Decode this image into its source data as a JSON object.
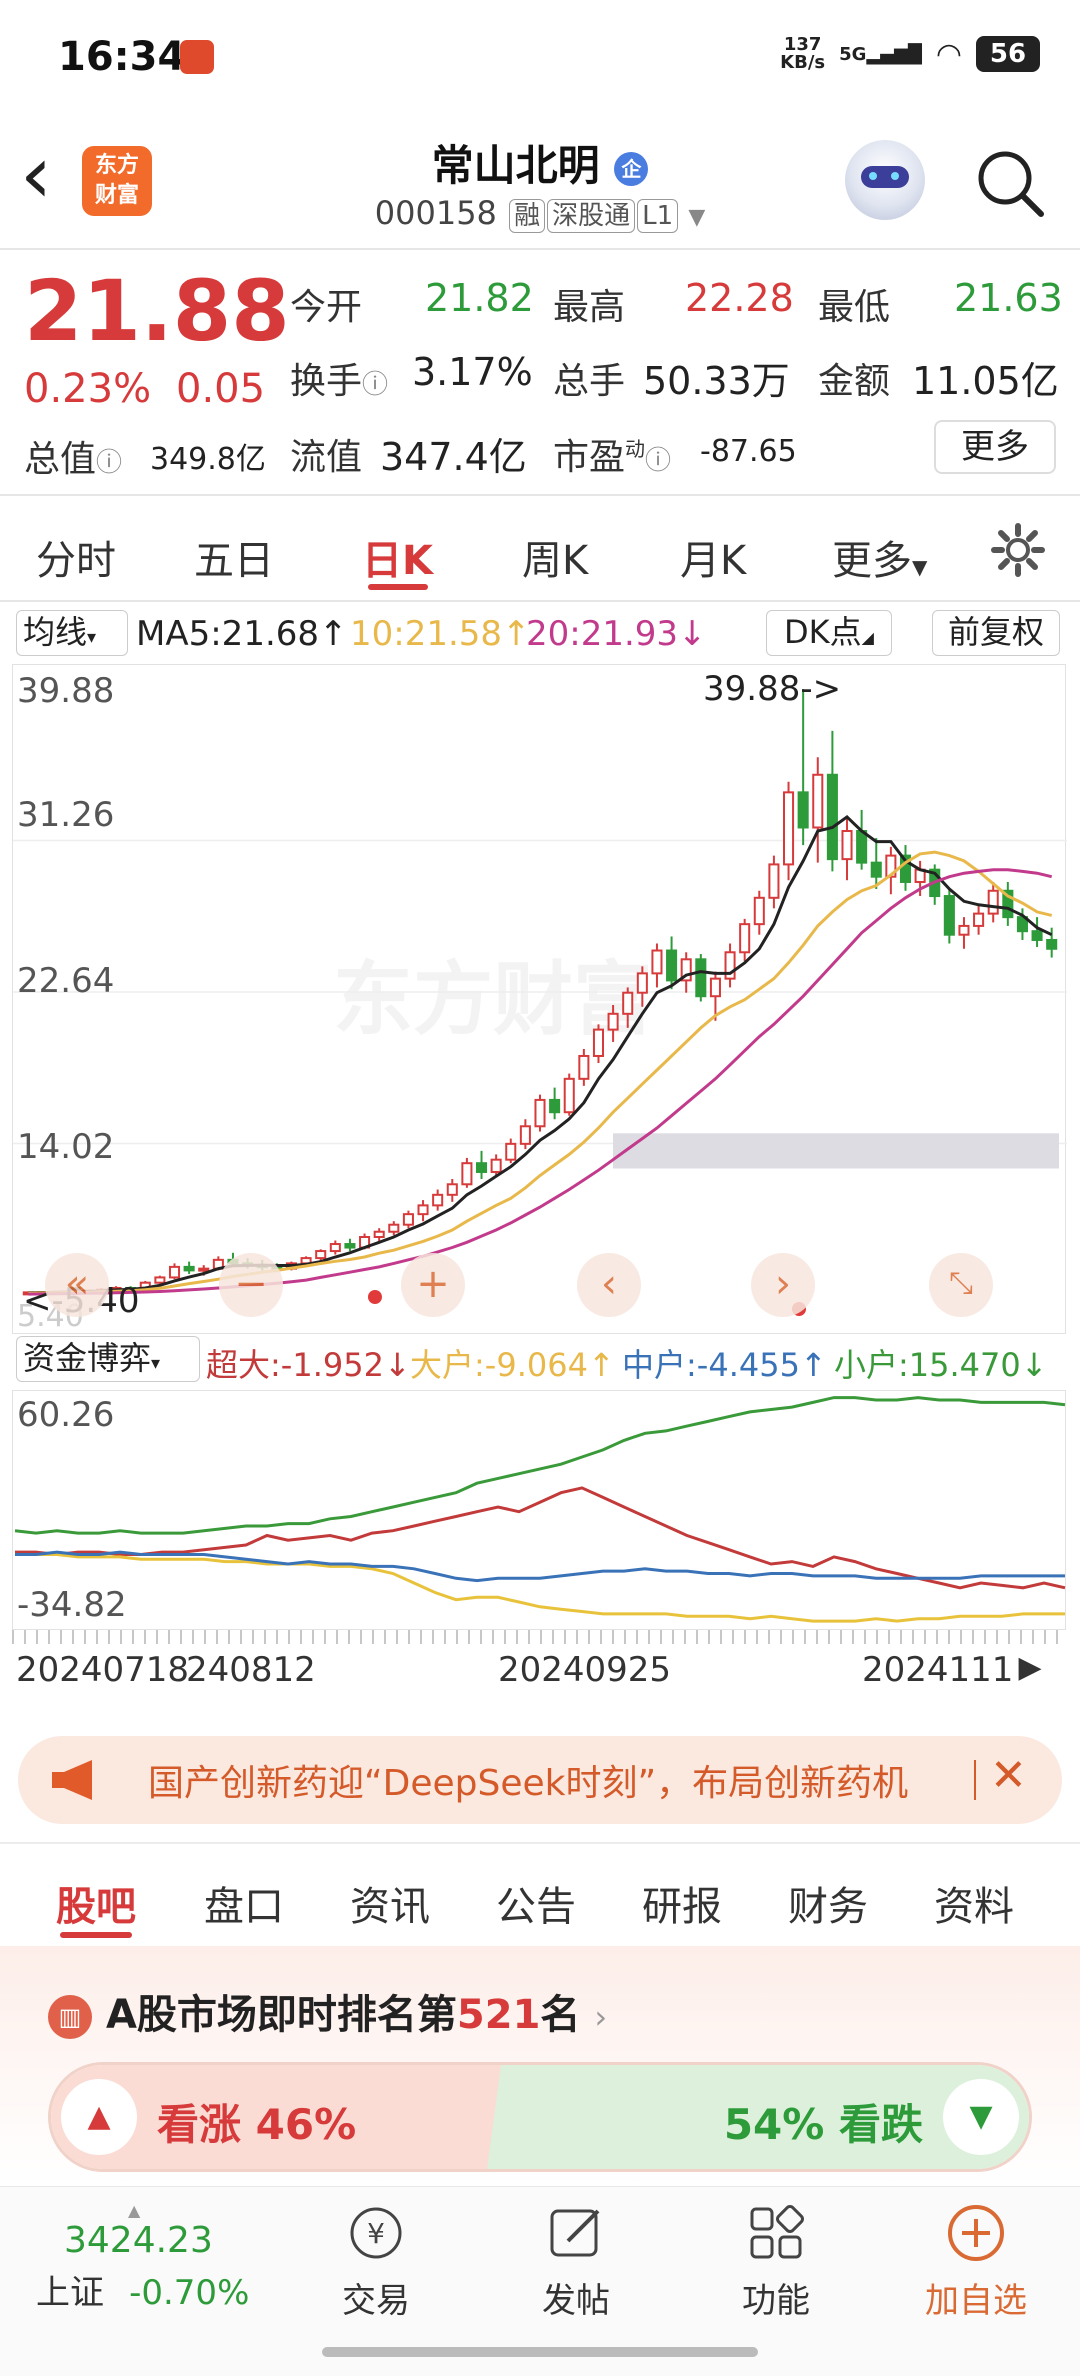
{
  "status_bar": {
    "time": "16:34",
    "speed": "137\nKB/s",
    "network": "5G",
    "battery": "56"
  },
  "header": {
    "back_label": "‹",
    "logo_text": "东方\n财富",
    "stock_name": "常山北明",
    "badge": "企",
    "code": "000158",
    "tags": [
      "融",
      "深股通",
      "L1"
    ]
  },
  "quote": {
    "price": "21.88",
    "change_pct": "0.23%",
    "change": "0.05",
    "open_label": "今开",
    "open": "21.82",
    "high_label": "最高",
    "high": "22.28",
    "low_label": "最低",
    "low": "21.63",
    "turnover_label": "换手",
    "turnover": "3.17%",
    "volume_label": "总手",
    "volume": "50.33万",
    "amount_label": "金额",
    "amount": "11.05亿",
    "mktcap_label": "总值",
    "mktcap": "349.8亿",
    "float_label": "流值",
    "float_cap": "347.4亿",
    "pe_label": "市盈",
    "pe_sup": "动",
    "pe": "-87.65",
    "more_label": "更多"
  },
  "period_tabs": [
    "分时",
    "五日",
    "日K",
    "周K",
    "月K",
    "更多"
  ],
  "active_period": 2,
  "ma_bar": {
    "indicator": "均线",
    "ma5": "MA5:21.68↑",
    "ma10": "10:21.58↑",
    "ma20": "20:21.93↓",
    "dk": "DK点",
    "adjust": "前复权"
  },
  "colors": {
    "up": "#d63a3a",
    "down": "#2e9b3a",
    "ma5": "#222222",
    "ma10": "#e8b84a",
    "ma20": "#c23a8c",
    "accent": "#d96a34"
  },
  "chart_data": [
    {
      "type": "candlestick",
      "y_ticks": [
        "39.88",
        "31.26",
        "22.64",
        "14.02",
        "5.40"
      ],
      "ylim": [
        5.4,
        39.88
      ],
      "annotations": [
        "39.88->",
        "<-5.40"
      ],
      "candles": [
        [
          5.5,
          5.6,
          5.4,
          5.55
        ],
        [
          5.55,
          5.6,
          5.5,
          5.5
        ],
        [
          5.5,
          5.6,
          5.45,
          5.58
        ],
        [
          5.58,
          5.7,
          5.5,
          5.6
        ],
        [
          5.6,
          5.7,
          5.55,
          5.65
        ],
        [
          5.65,
          5.8,
          5.6,
          5.7
        ],
        [
          5.7,
          5.9,
          5.65,
          5.8
        ],
        [
          5.8,
          5.9,
          5.7,
          5.75
        ],
        [
          5.75,
          6.2,
          5.7,
          6.1
        ],
        [
          6.1,
          6.5,
          6.0,
          6.4
        ],
        [
          6.4,
          7.2,
          6.3,
          7.0
        ],
        [
          7.0,
          7.3,
          6.6,
          6.8
        ],
        [
          6.8,
          7.1,
          6.5,
          6.9
        ],
        [
          6.9,
          7.6,
          6.8,
          7.4
        ],
        [
          7.4,
          7.8,
          7.0,
          7.2
        ],
        [
          7.2,
          7.5,
          6.9,
          7.1
        ],
        [
          7.1,
          7.4,
          6.8,
          7.0
        ],
        [
          7.0,
          7.2,
          6.7,
          6.9
        ],
        [
          6.9,
          7.3,
          6.8,
          7.2
        ],
        [
          7.2,
          7.6,
          7.0,
          7.5
        ],
        [
          7.5,
          8.0,
          7.3,
          7.9
        ],
        [
          7.9,
          8.5,
          7.7,
          8.3
        ],
        [
          8.3,
          8.6,
          7.9,
          8.1
        ],
        [
          8.1,
          8.9,
          8.0,
          8.7
        ],
        [
          8.7,
          9.2,
          8.4,
          9.0
        ],
        [
          9.0,
          9.6,
          8.8,
          9.4
        ],
        [
          9.4,
          10.2,
          9.2,
          10.0
        ],
        [
          10.0,
          10.8,
          9.6,
          10.5
        ],
        [
          10.5,
          11.4,
          10.2,
          11.1
        ],
        [
          11.1,
          12.0,
          10.7,
          11.7
        ],
        [
          11.7,
          13.2,
          11.5,
          12.9
        ],
        [
          12.9,
          13.6,
          12.0,
          12.4
        ],
        [
          12.4,
          13.4,
          12.2,
          13.1
        ],
        [
          13.1,
          14.3,
          12.9,
          14.0
        ],
        [
          14.0,
          15.4,
          13.7,
          15.0
        ],
        [
          15.0,
          16.8,
          14.7,
          16.5
        ],
        [
          16.5,
          17.2,
          15.4,
          15.8
        ],
        [
          15.8,
          18.0,
          15.6,
          17.7
        ],
        [
          17.7,
          19.4,
          17.3,
          19.0
        ],
        [
          19.0,
          20.8,
          18.6,
          20.5
        ],
        [
          20.5,
          21.9,
          19.8,
          21.4
        ],
        [
          21.4,
          22.9,
          20.6,
          22.6
        ],
        [
          22.6,
          24.1,
          21.8,
          23.7
        ],
        [
          23.7,
          25.4,
          22.9,
          25.0
        ],
        [
          25.0,
          25.8,
          22.8,
          23.3
        ],
        [
          23.3,
          24.9,
          22.6,
          24.5
        ],
        [
          24.5,
          24.8,
          22.1,
          22.4
        ],
        [
          22.4,
          23.8,
          21.0,
          23.4
        ],
        [
          23.4,
          25.4,
          22.9,
          24.9
        ],
        [
          24.9,
          26.8,
          24.4,
          26.5
        ],
        [
          26.5,
          28.4,
          25.9,
          28.0
        ],
        [
          28.0,
          30.4,
          27.4,
          29.9
        ],
        [
          29.9,
          34.6,
          29.0,
          34.0
        ],
        [
          34.0,
          39.88,
          31.0,
          32.0
        ],
        [
          32.0,
          36.0,
          30.0,
          35.0
        ],
        [
          35.0,
          37.5,
          29.5,
          30.2
        ],
        [
          30.2,
          32.6,
          29.0,
          31.8
        ],
        [
          31.8,
          33.0,
          29.6,
          30.0
        ],
        [
          30.0,
          31.4,
          28.5,
          29.2
        ],
        [
          29.2,
          30.9,
          28.2,
          30.4
        ],
        [
          30.4,
          31.0,
          28.4,
          28.9
        ],
        [
          28.9,
          30.1,
          28.1,
          29.6
        ],
        [
          29.6,
          29.9,
          27.6,
          28.1
        ],
        [
          28.1,
          28.5,
          25.4,
          25.9
        ],
        [
          25.9,
          26.9,
          25.1,
          26.4
        ],
        [
          26.4,
          27.6,
          25.9,
          27.1
        ],
        [
          27.1,
          28.9,
          26.6,
          28.4
        ],
        [
          28.4,
          28.9,
          26.4,
          26.9
        ],
        [
          26.9,
          27.4,
          25.6,
          26.1
        ],
        [
          26.1,
          26.9,
          25.2,
          25.6
        ],
        [
          25.6,
          26.3,
          24.6,
          25.1
        ]
      ],
      "series": [
        {
          "name": "MA5",
          "values": [
            5.52,
            5.54,
            5.55,
            5.57,
            5.6,
            5.63,
            5.69,
            5.72,
            5.8,
            5.95,
            6.2,
            6.42,
            6.62,
            6.9,
            7.06,
            7.08,
            7.1,
            7.08,
            7.08,
            7.14,
            7.3,
            7.56,
            7.8,
            8.1,
            8.4,
            8.7,
            9.1,
            9.44,
            9.9,
            10.34,
            11.1,
            11.6,
            12.16,
            12.7,
            13.4,
            14.2,
            14.76,
            15.42,
            16.34,
            17.7,
            18.8,
            20.1,
            21.4,
            22.6,
            23.0,
            23.6,
            23.8,
            23.7,
            23.7,
            24.3,
            25.1,
            26.5,
            28.6,
            30.1,
            31.8,
            32.0,
            32.6,
            31.8,
            31.2,
            31.2,
            30.1,
            29.6,
            29.4,
            28.5,
            27.8,
            27.6,
            27.5,
            27.4,
            27.0,
            26.3,
            25.9
          ]
        },
        {
          "name": "MA10",
          "values": [
            5.5,
            5.52,
            5.53,
            5.54,
            5.55,
            5.58,
            5.61,
            5.64,
            5.7,
            5.78,
            5.91,
            6.05,
            6.17,
            6.3,
            6.45,
            6.58,
            6.7,
            6.8,
            6.93,
            7.05,
            7.19,
            7.32,
            7.42,
            7.56,
            7.78,
            7.95,
            8.2,
            8.45,
            8.75,
            9.1,
            9.6,
            10.05,
            10.5,
            10.9,
            11.5,
            12.2,
            12.8,
            13.4,
            14.1,
            14.9,
            15.8,
            16.6,
            17.4,
            18.2,
            19.0,
            19.8,
            20.6,
            21.3,
            21.8,
            22.2,
            22.8,
            23.4,
            24.3,
            25.3,
            26.4,
            27.2,
            27.9,
            28.4,
            28.7,
            29.3,
            30.0,
            30.5,
            30.6,
            30.4,
            30.1,
            29.5,
            28.8,
            28.1,
            27.7,
            27.2,
            27.0
          ]
        },
        {
          "name": "MA20",
          "values": [
            5.45,
            5.46,
            5.47,
            5.48,
            5.5,
            5.51,
            5.53,
            5.55,
            5.57,
            5.6,
            5.64,
            5.69,
            5.74,
            5.8,
            5.86,
            5.93,
            6.0,
            6.07,
            6.15,
            6.25,
            6.4,
            6.55,
            6.7,
            6.85,
            7.0,
            7.2,
            7.4,
            7.6,
            7.85,
            8.1,
            8.4,
            8.75,
            9.1,
            9.5,
            9.95,
            10.4,
            10.9,
            11.4,
            11.95,
            12.5,
            13.1,
            13.7,
            14.3,
            14.9,
            15.6,
            16.3,
            17.0,
            17.7,
            18.5,
            19.3,
            20.1,
            20.8,
            21.6,
            22.4,
            23.3,
            24.2,
            25.1,
            26.0,
            26.7,
            27.4,
            28.0,
            28.5,
            28.9,
            29.2,
            29.4,
            29.5,
            29.6,
            29.6,
            29.5,
            29.4,
            29.2
          ]
        }
      ]
    },
    {
      "type": "line",
      "title": "资金博弈",
      "y_ticks": [
        "60.26",
        "-34.82"
      ],
      "ylim": [
        -34.82,
        60.26
      ],
      "x_tick_labels": [
        "20240718",
        "240812",
        "20240925",
        "2024111"
      ],
      "series": [
        {
          "name": "超大",
          "label": "超大:-1.952↓",
          "color": "#c33a3a",
          "values": [
            -5,
            -5,
            -6,
            -5,
            -5,
            -6,
            -6,
            -5,
            -5,
            -4,
            -3,
            -2,
            2,
            0,
            1,
            2,
            0,
            3,
            4,
            6,
            8,
            10,
            12,
            14,
            12,
            16,
            20,
            22,
            18,
            14,
            10,
            6,
            2,
            -1,
            -4,
            -7,
            -10,
            -9,
            -11,
            -7,
            -9,
            -12,
            -14,
            -16,
            -18,
            -20,
            -18,
            -19,
            -20,
            -18,
            -20
          ]
        },
        {
          "name": "大户",
          "label": "大户:-9.064↑",
          "color": "#e8c23a",
          "values": [
            -6,
            -6,
            -6,
            -7,
            -7,
            -7,
            -8,
            -8,
            -8,
            -8,
            -9,
            -9,
            -10,
            -10,
            -10,
            -11,
            -11,
            -12,
            -14,
            -18,
            -22,
            -25,
            -24,
            -24,
            -26,
            -28,
            -29,
            -30,
            -31,
            -31,
            -31,
            -31,
            -32,
            -32,
            -32,
            -33,
            -32,
            -33,
            -34,
            -34,
            -34,
            -33,
            -34,
            -33,
            -33,
            -32,
            -32,
            -32,
            -31,
            -31,
            -31
          ]
        },
        {
          "name": "中户",
          "label": "中户:-4.455↑",
          "color": "#3a72b8",
          "values": [
            -6,
            -6,
            -5,
            -6,
            -6,
            -5,
            -6,
            -6,
            -6,
            -6,
            -7,
            -8,
            -9,
            -10,
            -9,
            -10,
            -10,
            -11,
            -11,
            -12,
            -14,
            -16,
            -17,
            -16,
            -16,
            -16,
            -15,
            -14,
            -13,
            -13,
            -12,
            -13,
            -13,
            -14,
            -14,
            -15,
            -14,
            -14,
            -15,
            -15,
            -15,
            -16,
            -16,
            -16,
            -16,
            -16,
            -15,
            -15,
            -15,
            -15,
            -15
          ]
        },
        {
          "name": "小户",
          "label": "小户:15.470↓",
          "color": "#3a9a3a",
          "values": [
            4,
            3,
            4,
            3,
            3,
            4,
            3,
            3,
            3,
            4,
            5,
            6,
            6,
            7,
            7,
            9,
            10,
            12,
            14,
            16,
            18,
            20,
            24,
            26,
            28,
            30,
            32,
            35,
            38,
            42,
            45,
            46,
            48,
            50,
            52,
            54,
            55,
            56,
            58,
            60,
            60,
            59,
            59,
            60,
            59,
            59,
            58,
            58,
            58,
            58,
            57
          ]
        }
      ]
    }
  ],
  "news": {
    "text": "国产创新药迎“DeepSeek时刻”，布局创新药机"
  },
  "bottom_tabs": [
    "股吧",
    "盘口",
    "资讯",
    "公告",
    "研报",
    "财务",
    "资料"
  ],
  "active_bottom_tab": 0,
  "ranking": {
    "prefix": "A股市场即时排名第",
    "rank": "521",
    "suffix": "名"
  },
  "sentiment": {
    "up_label": "看涨",
    "up_pct": "46%",
    "up_value": 0.46,
    "down_pct": "54%",
    "down_label": "看跌",
    "down_value": 0.54
  },
  "bottom_nav": {
    "index_value": "3424.23",
    "index_name": "上证",
    "index_change": "-0.70%",
    "items": [
      "交易",
      "发帖",
      "功能",
      "加自选"
    ]
  }
}
